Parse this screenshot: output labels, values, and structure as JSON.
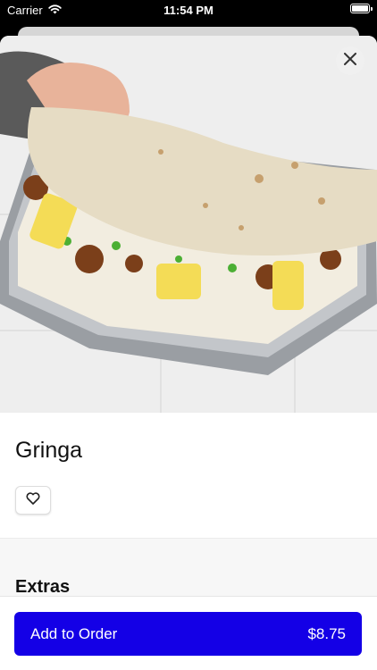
{
  "status_bar": {
    "carrier": "Carrier",
    "time": "11:54 PM"
  },
  "item": {
    "name": "Gringa"
  },
  "sections": {
    "extras_title": "Extras"
  },
  "order": {
    "button_label": "Add to Order",
    "price": "$8.75"
  },
  "icons": {
    "close": "close-icon",
    "favorite": "heart-icon",
    "wifi": "wifi-icon",
    "battery": "battery-icon"
  },
  "colors": {
    "accent": "#1400e6",
    "background": "#ffffff",
    "section_bg": "#f7f7f7"
  }
}
